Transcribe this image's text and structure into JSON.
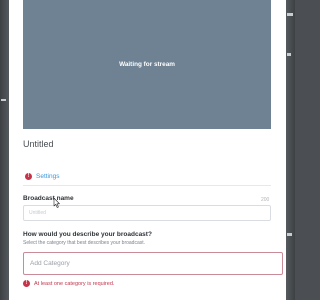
{
  "preview": {
    "status": "Waiting for stream"
  },
  "broadcast": {
    "title": "Untitled"
  },
  "tabs": [
    {
      "label": "Settings",
      "status_icon": "error-circle-icon",
      "active": true
    }
  ],
  "form": {
    "name_label": "Broadcast name",
    "name_counter": "200",
    "name_placeholder": "Untitled",
    "category_question": "How would you describe your broadcast?",
    "category_hint": "Select the category that best describes your broadcast.",
    "category_placeholder": "Add Category",
    "category_error": "At least one category is required."
  },
  "colors": {
    "accent": "#3c98db",
    "error": "#c4344b",
    "preview_bg": "#6e8293",
    "overlay": "#4b4f53"
  }
}
